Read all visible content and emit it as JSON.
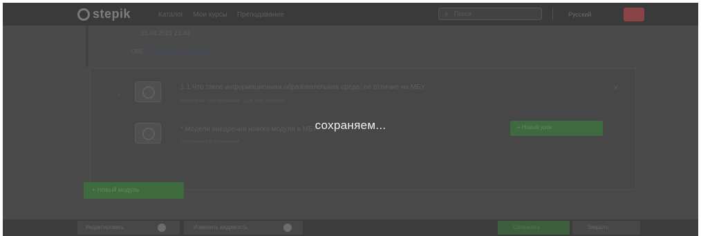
{
  "app": {
    "brand": "stepik",
    "nav": [
      "Каталог",
      "Мои курсы",
      "Преподавание"
    ],
    "search_placeholder": "Поиск",
    "language": "Русский"
  },
  "content": {
    "date": "15.04.2019 23:40",
    "meta_prefix": "ОБЕ",
    "meta_link": "Расширенные настройки ∨"
  },
  "items": [
    {
      "title": "1.1 Что такое информационная образовательная среда: её отличие на МБУ",
      "subtitle": "Различные составляющие · Для всех уровней"
    },
    {
      "title": "* Модели внедрения нового модуля в МБУ",
      "subtitle": "Сохранение и публикация"
    }
  ],
  "buttons": {
    "add_lesson": "+ Новый модуль",
    "publish": "+ Новый урок"
  },
  "bottombar": {
    "edit_structure": "Редактировать",
    "edit_settings": "Изменить видимость",
    "save": "Сохранить",
    "close": "Закрыть"
  },
  "overlay": {
    "status": "сохраняем..."
  },
  "colors": {
    "overlay": "#4a4a4a",
    "accent_green": "#3e6a3e",
    "status_text": "#f2f2f2"
  }
}
